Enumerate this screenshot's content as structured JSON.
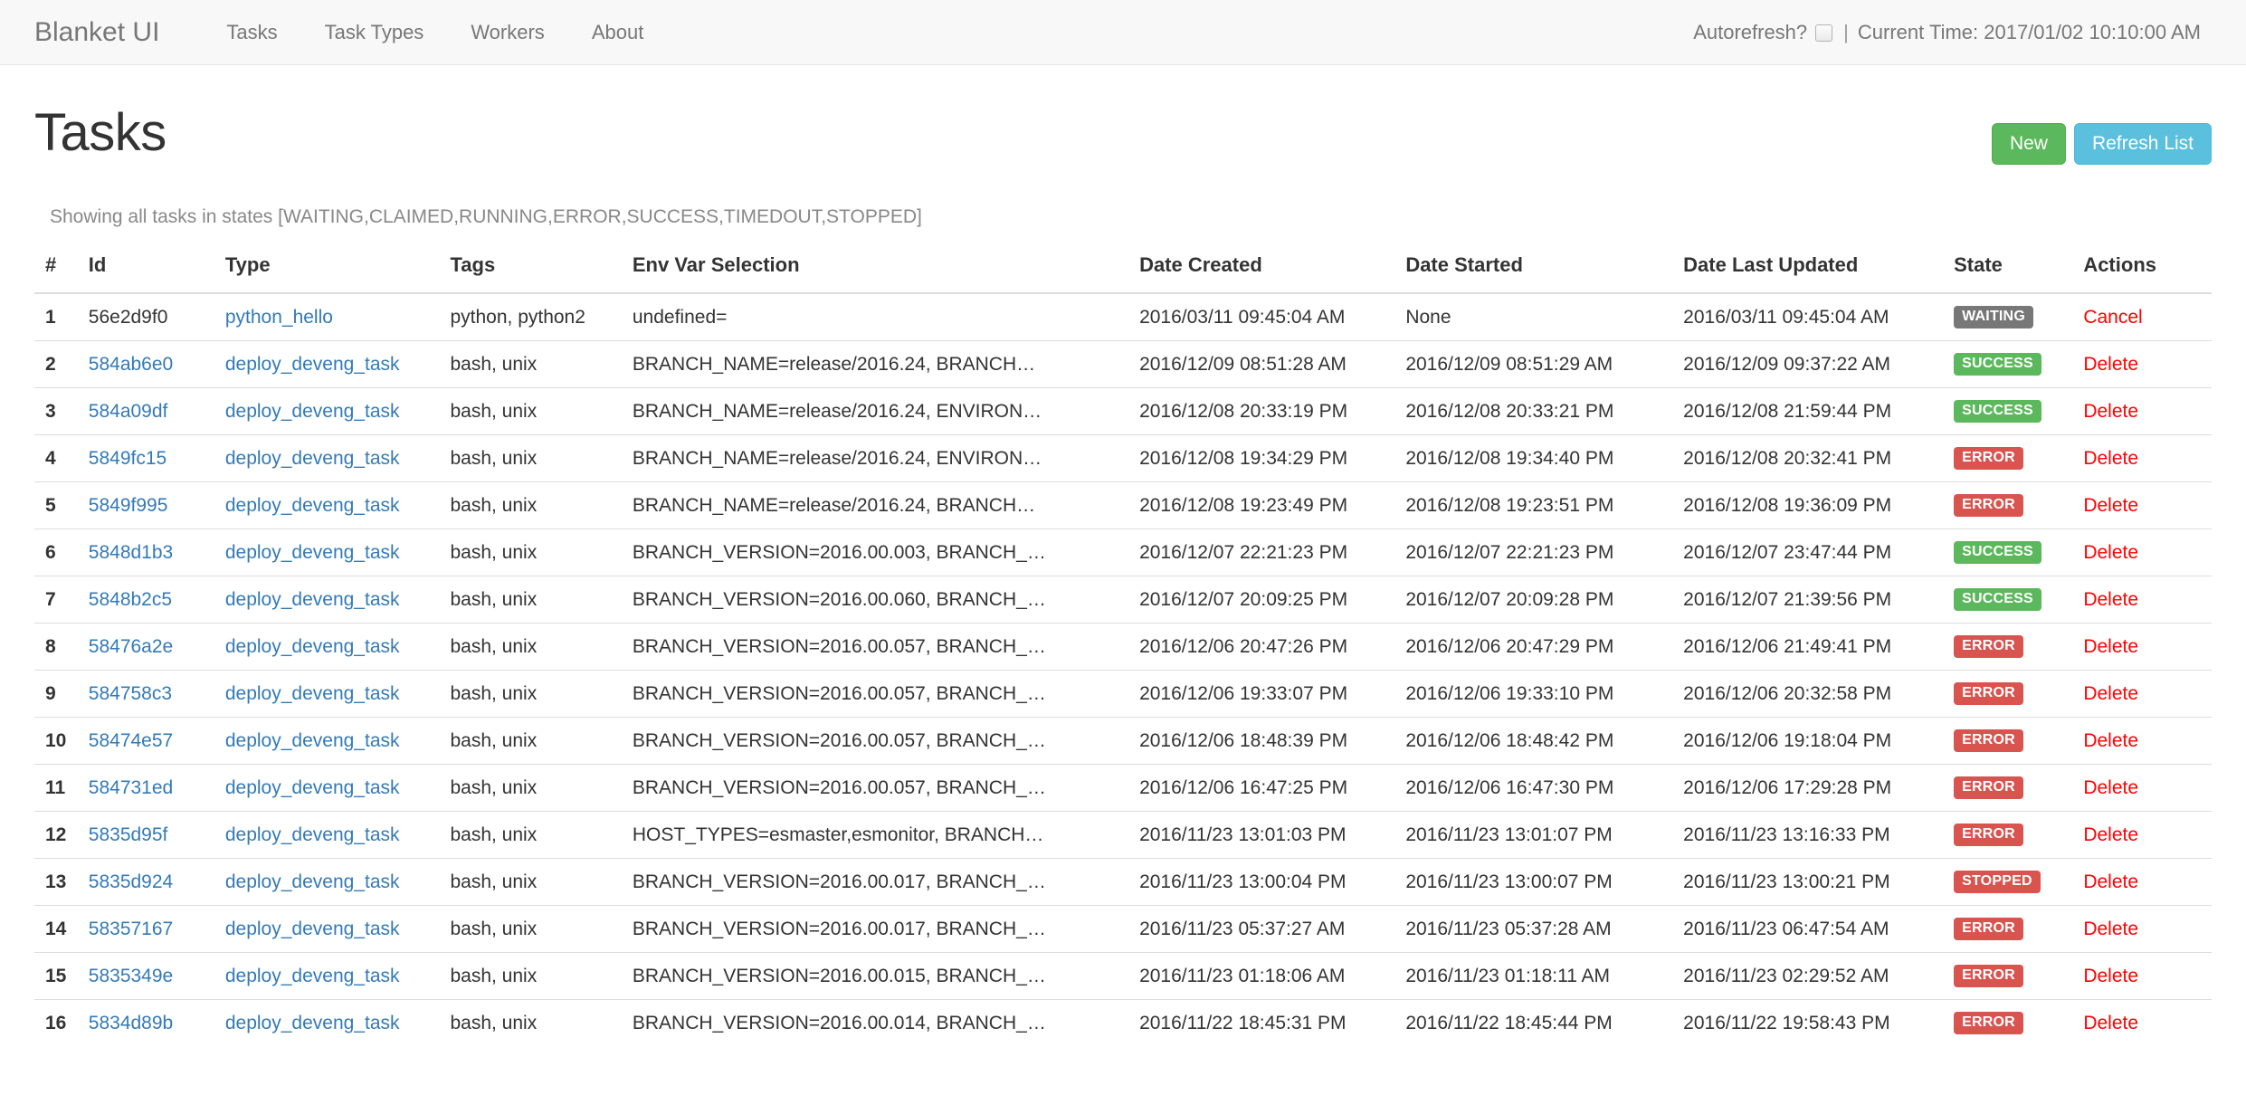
{
  "navbar": {
    "brand": "Blanket UI",
    "links": [
      {
        "label": "Tasks"
      },
      {
        "label": "Task Types"
      },
      {
        "label": "Workers"
      },
      {
        "label": "About"
      }
    ],
    "autorefresh_label": "Autorefresh?",
    "autorefresh_checked": false,
    "separator": "|",
    "current_time_label": "Current Time: 2017/01/02 10:10:00 AM"
  },
  "page": {
    "title": "Tasks",
    "subtitle": "Showing all tasks in states [WAITING,CLAIMED,RUNNING,ERROR,SUCCESS,TIMEDOUT,STOPPED]",
    "buttons": {
      "new": "New",
      "refresh": "Refresh List"
    }
  },
  "colors": {
    "link": "#337ab7",
    "danger_link": "#ff0000",
    "btn_success": "#5cb85c",
    "btn_info": "#5bc0de",
    "label_default": "#777777",
    "label_success": "#5cb85c",
    "label_danger": "#d9534f",
    "navbar_bg": "#f8f8f8"
  },
  "table": {
    "columns": [
      "#",
      "Id",
      "Type",
      "Tags",
      "Env Var Selection",
      "Date Created",
      "Date Started",
      "Date Last Updated",
      "State",
      "Actions"
    ],
    "rows": [
      {
        "num": "1",
        "id": "56e2d9f0",
        "id_is_link": false,
        "type": "python_hello",
        "tags": "python, python2",
        "env": "undefined=",
        "created": "2016/03/11 09:45:04 AM",
        "started": "None",
        "updated": "2016/03/11 09:45:04 AM",
        "state": "WAITING",
        "state_style": "default",
        "action": "Cancel"
      },
      {
        "num": "2",
        "id": "584ab6e0",
        "id_is_link": true,
        "type": "deploy_deveng_task",
        "tags": "bash, unix",
        "env": "BRANCH_NAME=release/2016.24, BRANCH…",
        "created": "2016/12/09 08:51:28 AM",
        "started": "2016/12/09 08:51:29 AM",
        "updated": "2016/12/09 09:37:22 AM",
        "state": "SUCCESS",
        "state_style": "success",
        "action": "Delete"
      },
      {
        "num": "3",
        "id": "584a09df",
        "id_is_link": true,
        "type": "deploy_deveng_task",
        "tags": "bash, unix",
        "env": "BRANCH_NAME=release/2016.24, ENVIRON…",
        "created": "2016/12/08 20:33:19 PM",
        "started": "2016/12/08 20:33:21 PM",
        "updated": "2016/12/08 21:59:44 PM",
        "state": "SUCCESS",
        "state_style": "success",
        "action": "Delete"
      },
      {
        "num": "4",
        "id": "5849fc15",
        "id_is_link": true,
        "type": "deploy_deveng_task",
        "tags": "bash, unix",
        "env": "BRANCH_NAME=release/2016.24, ENVIRON…",
        "created": "2016/12/08 19:34:29 PM",
        "started": "2016/12/08 19:34:40 PM",
        "updated": "2016/12/08 20:32:41 PM",
        "state": "ERROR",
        "state_style": "danger",
        "action": "Delete"
      },
      {
        "num": "5",
        "id": "5849f995",
        "id_is_link": true,
        "type": "deploy_deveng_task",
        "tags": "bash, unix",
        "env": "BRANCH_NAME=release/2016.24, BRANCH…",
        "created": "2016/12/08 19:23:49 PM",
        "started": "2016/12/08 19:23:51 PM",
        "updated": "2016/12/08 19:36:09 PM",
        "state": "ERROR",
        "state_style": "danger",
        "action": "Delete"
      },
      {
        "num": "6",
        "id": "5848d1b3",
        "id_is_link": true,
        "type": "deploy_deveng_task",
        "tags": "bash, unix",
        "env": "BRANCH_VERSION=2016.00.003, BRANCH_…",
        "created": "2016/12/07 22:21:23 PM",
        "started": "2016/12/07 22:21:23 PM",
        "updated": "2016/12/07 23:47:44 PM",
        "state": "SUCCESS",
        "state_style": "success",
        "action": "Delete"
      },
      {
        "num": "7",
        "id": "5848b2c5",
        "id_is_link": true,
        "type": "deploy_deveng_task",
        "tags": "bash, unix",
        "env": "BRANCH_VERSION=2016.00.060, BRANCH_…",
        "created": "2016/12/07 20:09:25 PM",
        "started": "2016/12/07 20:09:28 PM",
        "updated": "2016/12/07 21:39:56 PM",
        "state": "SUCCESS",
        "state_style": "success",
        "action": "Delete"
      },
      {
        "num": "8",
        "id": "58476a2e",
        "id_is_link": true,
        "type": "deploy_deveng_task",
        "tags": "bash, unix",
        "env": "BRANCH_VERSION=2016.00.057, BRANCH_…",
        "created": "2016/12/06 20:47:26 PM",
        "started": "2016/12/06 20:47:29 PM",
        "updated": "2016/12/06 21:49:41 PM",
        "state": "ERROR",
        "state_style": "danger",
        "action": "Delete"
      },
      {
        "num": "9",
        "id": "584758c3",
        "id_is_link": true,
        "type": "deploy_deveng_task",
        "tags": "bash, unix",
        "env": "BRANCH_VERSION=2016.00.057, BRANCH_…",
        "created": "2016/12/06 19:33:07 PM",
        "started": "2016/12/06 19:33:10 PM",
        "updated": "2016/12/06 20:32:58 PM",
        "state": "ERROR",
        "state_style": "danger",
        "action": "Delete"
      },
      {
        "num": "10",
        "id": "58474e57",
        "id_is_link": true,
        "type": "deploy_deveng_task",
        "tags": "bash, unix",
        "env": "BRANCH_VERSION=2016.00.057, BRANCH_…",
        "created": "2016/12/06 18:48:39 PM",
        "started": "2016/12/06 18:48:42 PM",
        "updated": "2016/12/06 19:18:04 PM",
        "state": "ERROR",
        "state_style": "danger",
        "action": "Delete"
      },
      {
        "num": "11",
        "id": "584731ed",
        "id_is_link": true,
        "type": "deploy_deveng_task",
        "tags": "bash, unix",
        "env": "BRANCH_VERSION=2016.00.057, BRANCH_…",
        "created": "2016/12/06 16:47:25 PM",
        "started": "2016/12/06 16:47:30 PM",
        "updated": "2016/12/06 17:29:28 PM",
        "state": "ERROR",
        "state_style": "danger",
        "action": "Delete"
      },
      {
        "num": "12",
        "id": "5835d95f",
        "id_is_link": true,
        "type": "deploy_deveng_task",
        "tags": "bash, unix",
        "env": "HOST_TYPES=esmaster,esmonitor, BRANCH…",
        "created": "2016/11/23 13:01:03 PM",
        "started": "2016/11/23 13:01:07 PM",
        "updated": "2016/11/23 13:16:33 PM",
        "state": "ERROR",
        "state_style": "danger",
        "action": "Delete"
      },
      {
        "num": "13",
        "id": "5835d924",
        "id_is_link": true,
        "type": "deploy_deveng_task",
        "tags": "bash, unix",
        "env": "BRANCH_VERSION=2016.00.017, BRANCH_…",
        "created": "2016/11/23 13:00:04 PM",
        "started": "2016/11/23 13:00:07 PM",
        "updated": "2016/11/23 13:00:21 PM",
        "state": "STOPPED",
        "state_style": "danger",
        "action": "Delete"
      },
      {
        "num": "14",
        "id": "58357167",
        "id_is_link": true,
        "type": "deploy_deveng_task",
        "tags": "bash, unix",
        "env": "BRANCH_VERSION=2016.00.017, BRANCH_…",
        "created": "2016/11/23 05:37:27 AM",
        "started": "2016/11/23 05:37:28 AM",
        "updated": "2016/11/23 06:47:54 AM",
        "state": "ERROR",
        "state_style": "danger",
        "action": "Delete"
      },
      {
        "num": "15",
        "id": "5835349e",
        "id_is_link": true,
        "type": "deploy_deveng_task",
        "tags": "bash, unix",
        "env": "BRANCH_VERSION=2016.00.015, BRANCH_…",
        "created": "2016/11/23 01:18:06 AM",
        "started": "2016/11/23 01:18:11 AM",
        "updated": "2016/11/23 02:29:52 AM",
        "state": "ERROR",
        "state_style": "danger",
        "action": "Delete"
      },
      {
        "num": "16",
        "id": "5834d89b",
        "id_is_link": true,
        "type": "deploy_deveng_task",
        "tags": "bash, unix",
        "env": "BRANCH_VERSION=2016.00.014, BRANCH_…",
        "created": "2016/11/22 18:45:31 PM",
        "started": "2016/11/22 18:45:44 PM",
        "updated": "2016/11/22 19:58:43 PM",
        "state": "ERROR",
        "state_style": "danger",
        "action": "Delete"
      }
    ]
  }
}
